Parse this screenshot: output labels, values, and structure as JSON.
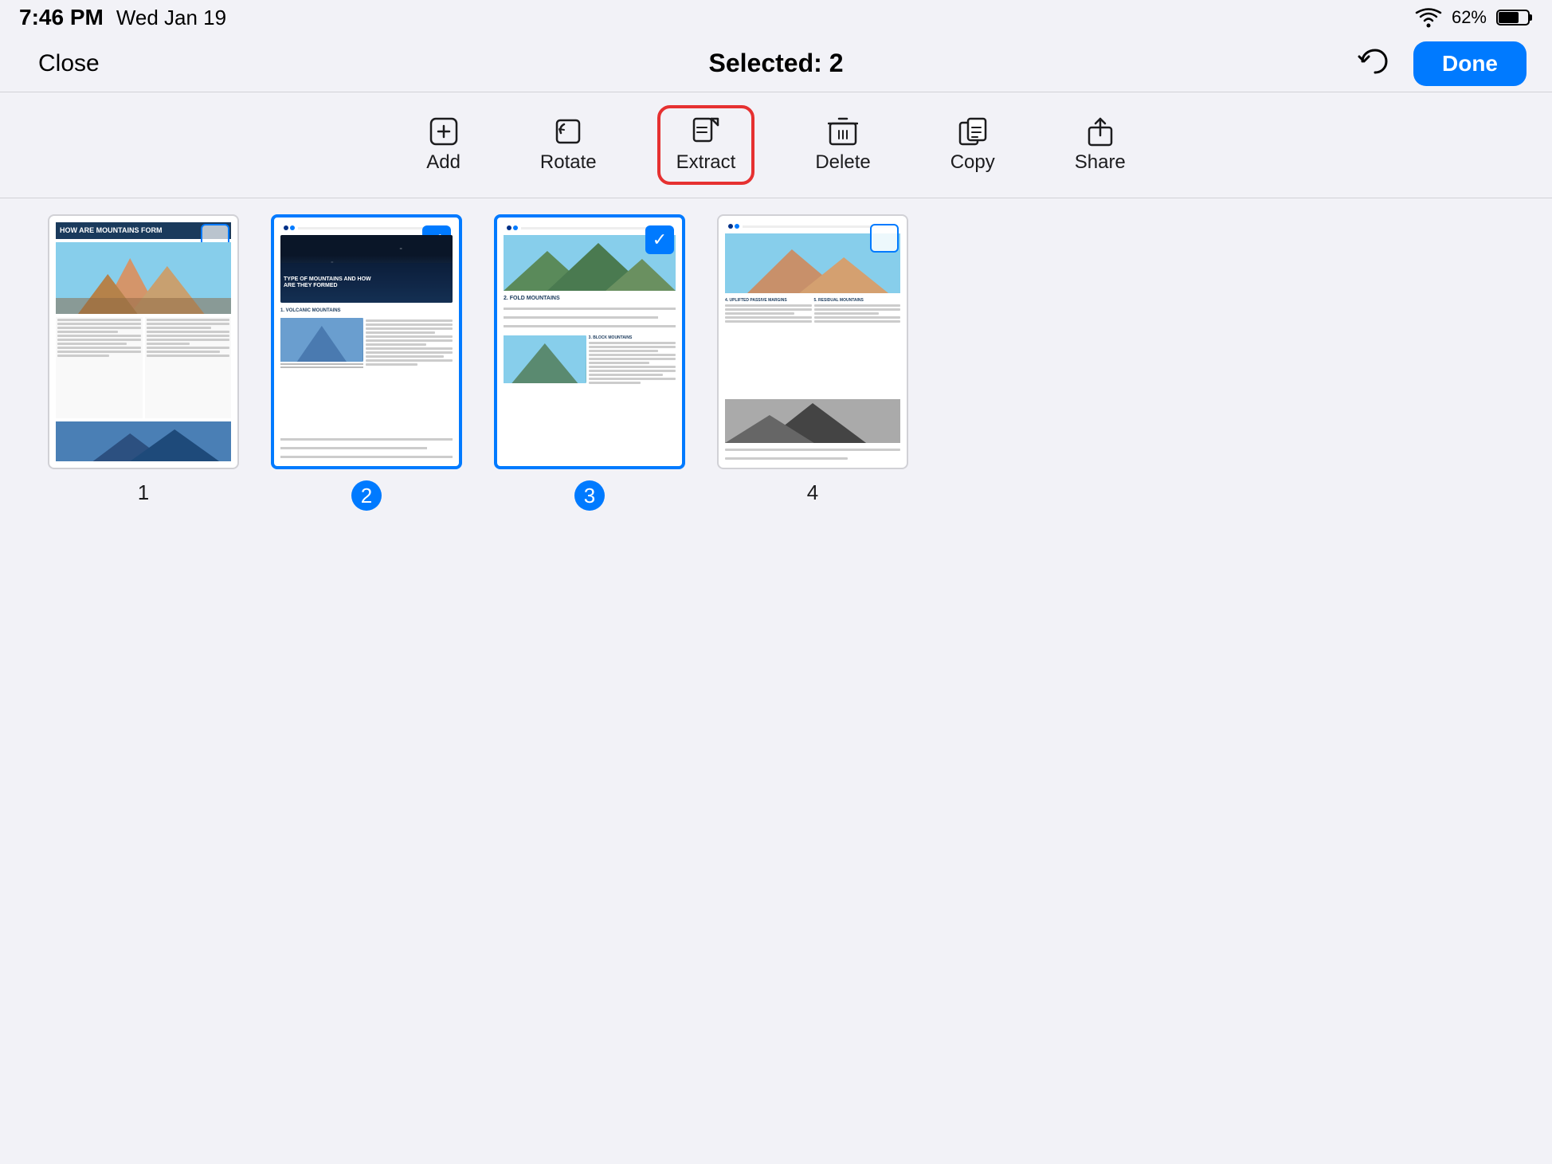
{
  "statusBar": {
    "time": "7:46 PM",
    "date": "Wed Jan 19",
    "wifi": "wifi",
    "battery": "62%"
  },
  "header": {
    "close_label": "Close",
    "title": "Selected: 2",
    "done_label": "Done"
  },
  "toolbar": {
    "add_label": "Add",
    "rotate_label": "Rotate",
    "extract_label": "Extract",
    "delete_label": "Delete",
    "copy_label": "Copy",
    "share_label": "Share"
  },
  "pages": [
    {
      "number": "1",
      "selected": false,
      "checked": false
    },
    {
      "number": "2",
      "selected": true,
      "checked": true
    },
    {
      "number": "3",
      "selected": true,
      "checked": true
    },
    {
      "number": "4",
      "selected": false,
      "checked": false
    }
  ]
}
